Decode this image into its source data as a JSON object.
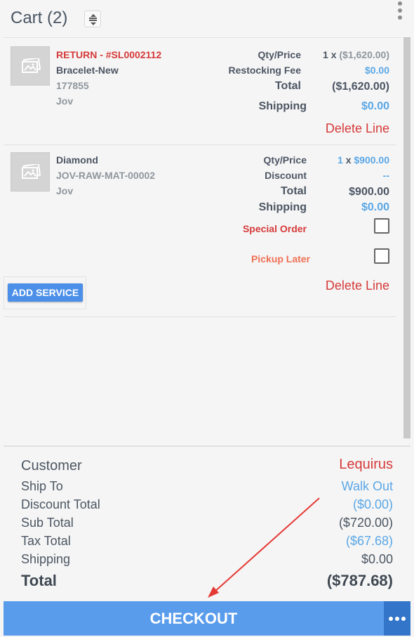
{
  "header": {
    "title": "Cart (2)"
  },
  "items": [
    {
      "title": "RETURN - #SL0002112",
      "name": "Bracelet-New",
      "sku": "177855",
      "vendor": "Jov",
      "qty_price_label": "Qty/Price",
      "qty": "1 x",
      "price": "($1,620.00)",
      "fee_label": "Restocking Fee",
      "fee": "$0.00",
      "total_label": "Total",
      "total": "($1,620.00)",
      "shipping_label": "Shipping",
      "shipping": "$0.00",
      "delete_label": "Delete Line"
    },
    {
      "name": "Diamond",
      "sku": "JOV-RAW-MAT-00002",
      "vendor": "Jov",
      "qty_price_label": "Qty/Price",
      "qty": "1",
      "x": "x",
      "price": "$900.00",
      "discount_label": "Discount",
      "discount": "--",
      "total_label": "Total",
      "total": "$900.00",
      "shipping_label": "Shipping",
      "shipping": "$0.00",
      "special_order_label": "Special Order",
      "pickup_later_label": "Pickup Later",
      "add_service_label": "ADD SERVICE",
      "delete_label": "Delete Line"
    }
  ],
  "summary": {
    "customer_label": "Customer",
    "customer": "Lequirus",
    "ship_to_label": "Ship To",
    "ship_to": "Walk Out",
    "discount_total_label": "Discount Total",
    "discount_total": "($0.00)",
    "sub_total_label": "Sub Total",
    "sub_total": "($720.00)",
    "tax_total_label": "Tax Total",
    "tax_total": "($67.68)",
    "shipping_label": "Shipping",
    "shipping": "$0.00",
    "total_label": "Total",
    "total": "($787.68)"
  },
  "checkout": {
    "label": "CHECKOUT"
  },
  "colors": {
    "accent": "#5a9cec",
    "danger": "#d63a3a",
    "link": "#5aa7e6",
    "annotation": "#e53935"
  }
}
